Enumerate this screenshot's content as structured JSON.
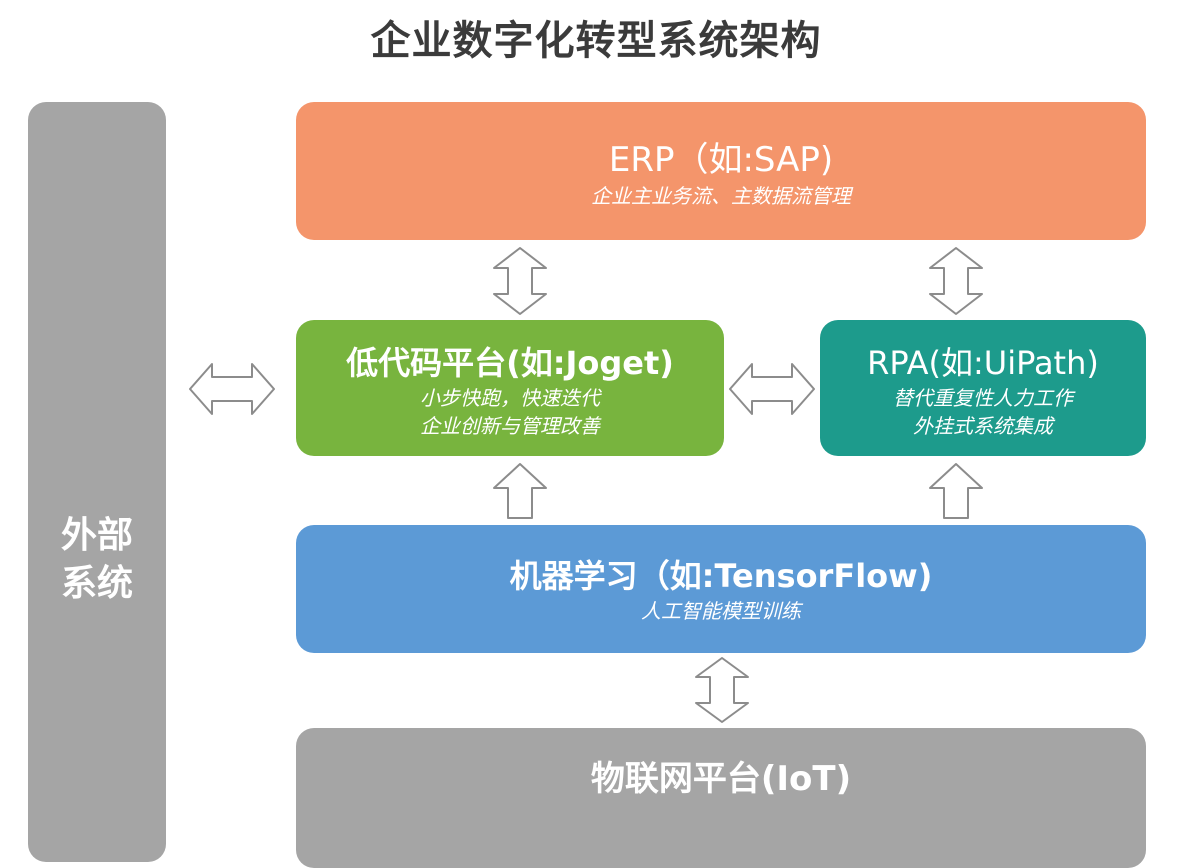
{
  "title": "企业数字化转型系统架构",
  "external": {
    "line1": "外部",
    "line2": "系统"
  },
  "erp": {
    "main": "ERP（如:SAP)",
    "sub": "企业主业务流、主数据流管理"
  },
  "lowcode": {
    "main": "低代码平台(如:Joget)",
    "sub1": "小步快跑，快速迭代",
    "sub2": "企业创新与管理改善"
  },
  "rpa": {
    "main": "RPA(如:UiPath)",
    "sub1": "替代重复性人力工作",
    "sub2": "外挂式系统集成"
  },
  "ml": {
    "main": "机器学习（如:TensorFlow)",
    "sub": "人工智能模型训练"
  },
  "iot": {
    "main": "物联网平台(IoT)"
  },
  "colors": {
    "erp": "#f4956b",
    "lowcode": "#78b43e",
    "rpa": "#1d9b8c",
    "ml": "#5c9ad6",
    "external": "#a5a5a5",
    "iot": "#a5a5a5"
  }
}
